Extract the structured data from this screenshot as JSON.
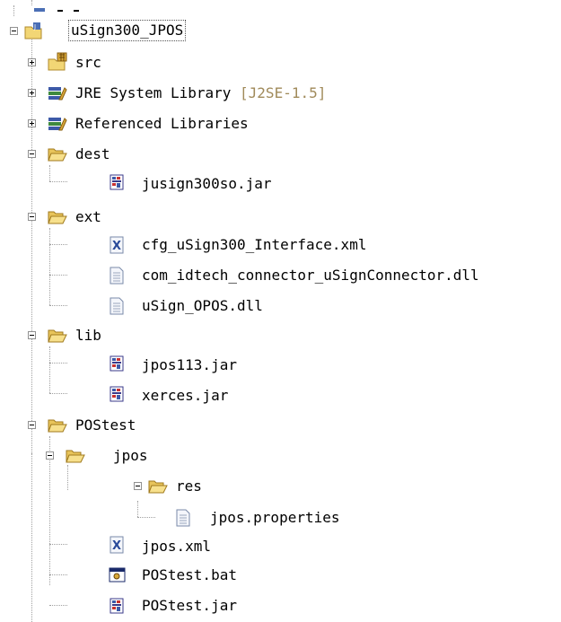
{
  "tree": {
    "project": {
      "label": "uSign300_JPOS"
    },
    "src": {
      "label": "src"
    },
    "jre": {
      "label": "JRE System Library",
      "decoration": "[J2SE-1.5]"
    },
    "referenced": {
      "label": "Referenced Libraries"
    },
    "dest": {
      "label": "dest",
      "files": [
        {
          "label": "jusign300so.jar"
        }
      ]
    },
    "ext": {
      "label": "ext",
      "files": [
        {
          "label": "cfg_uSign300_Interface.xml"
        },
        {
          "label": "com_idtech_connector_uSignConnector.dll"
        },
        {
          "label": "uSign_OPOS.dll"
        }
      ]
    },
    "lib": {
      "label": "lib",
      "files": [
        {
          "label": "jpos113.jar"
        },
        {
          "label": "xerces.jar"
        }
      ]
    },
    "postest": {
      "label": "POStest",
      "jpos": {
        "label": "jpos",
        "res": {
          "label": "res",
          "files": [
            {
              "label": "jpos.properties"
            }
          ]
        }
      },
      "files": [
        {
          "label": "jpos.xml"
        },
        {
          "label": "POStest.bat"
        },
        {
          "label": "POStest.jar"
        }
      ]
    }
  },
  "icons": {
    "folder": "folder-open-icon",
    "jar": "jar-icon",
    "xml": "xml-file-icon",
    "file": "text-file-icon",
    "bat": "bat-file-icon",
    "library": "library-icon",
    "package": "source-folder-icon",
    "project": "java-project-icon"
  },
  "colors": {
    "decoration": "#a08a5a",
    "folder": "#f2d675",
    "jar_red": "#c83232",
    "library_blue": "#3d5aa8",
    "library_green": "#3f8a3f"
  }
}
